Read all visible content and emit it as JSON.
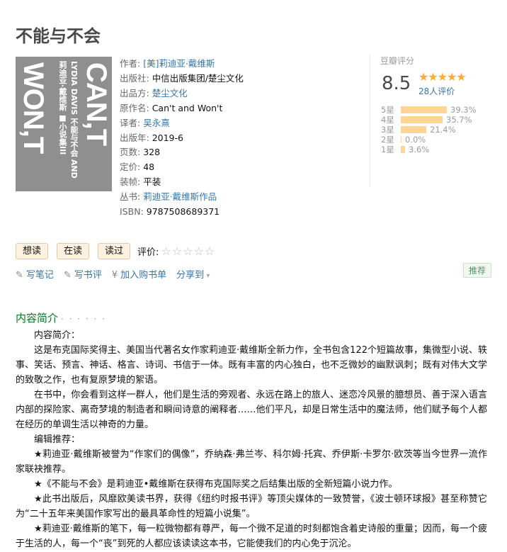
{
  "book": {
    "title": "不能与不会",
    "cover": {
      "left_title": "WON,T",
      "right_title": "CAN,T",
      "mid_line1": "莉迪亚·戴维斯 ■小说集III",
      "mid_line2": "LYDIA DAVIS 不能与不会 AND"
    }
  },
  "info": [
    {
      "label": "作者:",
      "value": "[美]莉迪亚·戴维斯",
      "link": true
    },
    {
      "label": "出版社:",
      "value": "中信出版集团/楚尘文化",
      "link": false
    },
    {
      "label": "出品方:",
      "value": "楚尘文化",
      "link": true
    },
    {
      "label": "原作名:",
      "value": "Can't and Won't",
      "link": false
    },
    {
      "label": "译者:",
      "value": "吴永熹",
      "link": true
    },
    {
      "label": "出版年:",
      "value": "2019-6",
      "link": false
    },
    {
      "label": "页数:",
      "value": "328",
      "link": false
    },
    {
      "label": "定价:",
      "value": "48",
      "link": false
    },
    {
      "label": "装帧:",
      "value": "平装",
      "link": false
    },
    {
      "label": "丛书:",
      "value": "莉迪亚·戴维斯作品",
      "link": true
    },
    {
      "label": "ISBN:",
      "value": "9787508689371",
      "link": false
    }
  ],
  "rating": {
    "label": "豆瓣评分",
    "score": "8.5",
    "stars_display": "★★★★★",
    "count": "28人评价",
    "bars": [
      {
        "label": "5星",
        "percent_text": "39.3%",
        "fraction": 0.393
      },
      {
        "label": "4星",
        "percent_text": "35.7%",
        "fraction": 0.357
      },
      {
        "label": "3星",
        "percent_text": "21.4%",
        "fraction": 0.214
      },
      {
        "label": "2星",
        "percent_text": "0.0%",
        "fraction": 0.0
      },
      {
        "label": "1星",
        "percent_text": "3.6%",
        "fraction": 0.036
      }
    ]
  },
  "actions": {
    "want": "想读",
    "reading": "在读",
    "read": "读过",
    "rate_label": "评价:",
    "rate_stars": "☆☆☆☆☆"
  },
  "tools": {
    "note": "写笔记",
    "review": "写书评",
    "cart": "加入购书单",
    "share": "分享到",
    "recommend": "推荐"
  },
  "intro": {
    "section_title": "内容简介",
    "dots": "· · · · · ·",
    "paragraphs": [
      "内容简介：",
      "这是布克国际奖得主、美国当代著名女作家莉迪亚·戴维斯全新力作，全书包含122个短篇故事，集微型小说、轶事、笑话、预言、神话、格言、诗词、书信于一体。既有丰富的内心独白，也不乏微妙的幽默讽刺；既有对伟大文学的致敬之作，也有复原梦境的絮语。",
      "在书中，你会看到这样一群人，他们是生活的旁观者、永远在路上的旅人、迷恋冷风景的臆想员、善于深入语言内部的探险家、离奇梦境的制造者和瞬间诗意的阐释者……他们平凡，却是日常生活中的魔法师，他们赋予每个人都在经历的单调生活以神奇的力量。",
      "编辑推荐：",
      "★莉迪亚·戴维斯被誉为“作家们的偶像”，乔纳森·弗兰岑、科尔姆·托宾、乔伊斯·卡罗尔·欧茨等当今世界一流作家联袂推荐。",
      "★《不能与不会》是莉迪亚•戴维斯在获得布克国际奖之后结集出版的全新短篇小说力作。",
      "★此书出版后，风靡欧美读书界，获得《纽约时报书评》等顶尖媒体的一致赞誉，《波士顿环球报》甚至称赞它为“二十五年来美国作家写出的最具革命性的短篇小说集”。",
      "★莉迪亚·戴维斯的笔下，每一粒微物都有尊严，每一个微不足道的时刻都饱含着史诗般的重量；因而，每一个疲于生活的人，每一个“丧”到死的人都应该读读这本书，它能使我们的内心免于沉沦。"
    ]
  }
}
